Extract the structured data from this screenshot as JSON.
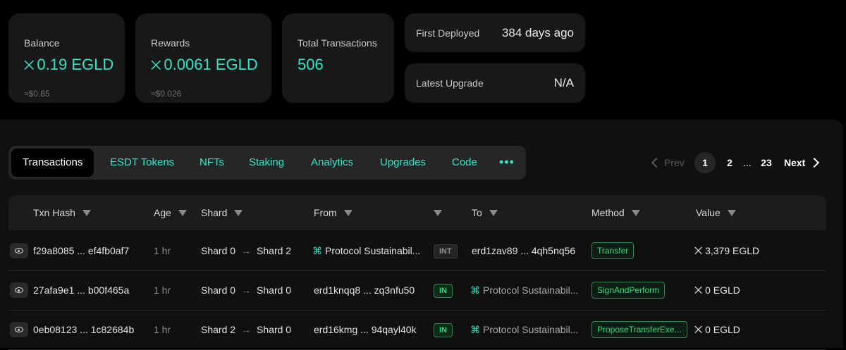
{
  "stats": {
    "balance": {
      "label": "Balance",
      "symbol": "⨉",
      "value": "0.19 EGLD",
      "usd": "≈$0.85"
    },
    "rewards": {
      "label": "Rewards",
      "symbol": "⨉",
      "value": "0.0061 EGLD",
      "usd": "≈$0.026"
    },
    "total": {
      "label": "Total Transactions",
      "value": "506"
    },
    "deployed": {
      "label": "First Deployed",
      "value": "384 days ago"
    },
    "upgrade": {
      "label": "Latest Upgrade",
      "value": "N/A"
    }
  },
  "tabs": [
    "Transactions",
    "ESDT Tokens",
    "NFTs",
    "Staking",
    "Analytics",
    "Upgrades",
    "Code"
  ],
  "tabs_more": "•••",
  "pager": {
    "prev": "Prev",
    "pages": [
      "1",
      "2"
    ],
    "ellipsis": "...",
    "last": "23",
    "next": "Next"
  },
  "columns": [
    "Txn Hash",
    "Age",
    "Shard",
    "From",
    "To",
    "Method",
    "Value"
  ],
  "rows": [
    {
      "hash": "f29a8085 ... ef4fb0af7",
      "age": "1 hr",
      "shard_from": "Shard 0",
      "shard_to": "Shard 2",
      "from": "Protocol Sustainabil...",
      "from_contract": true,
      "direction": "INT",
      "to": "erd1zav89 ... 4qh5nq56",
      "to_contract": false,
      "method": "Transfer",
      "value": "3,379 EGLD"
    },
    {
      "hash": "27afa9e1 ... b00f465a",
      "age": "1 hr",
      "shard_from": "Shard 0",
      "shard_to": "Shard 0",
      "from": "erd1knqq8 ... zq3nfu50",
      "from_contract": false,
      "direction": "IN",
      "to": "Protocol Sustainabil...",
      "to_contract": true,
      "method": "SignAndPerform",
      "value": "0 EGLD"
    },
    {
      "hash": "0eb08123 ... 1c82684b",
      "age": "1 hr",
      "shard_from": "Shard 2",
      "shard_to": "Shard 0",
      "from": "erd16kmg ... 94qayl40k",
      "from_contract": false,
      "direction": "IN",
      "to": "Protocol Sustainabil...",
      "to_contract": true,
      "method": "ProposeTransferExe...",
      "value": "0 EGLD"
    }
  ],
  "symbols": {
    "egld": "⨉",
    "arrow": "→",
    "contract": "⌘"
  },
  "colors": {
    "accent": "#2fe6c6",
    "in_badge": "#37d67a",
    "background": "#000000",
    "card": "#181818"
  }
}
